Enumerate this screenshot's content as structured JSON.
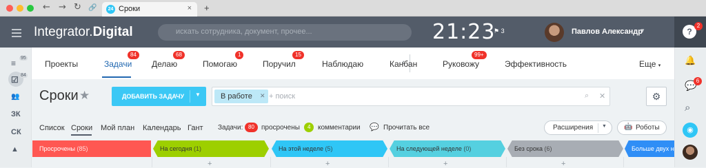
{
  "browser": {
    "tab_title": "Сроки",
    "tab_favicon": "24",
    "tab_close": "×",
    "new_tab": "+",
    "back_icon": "←",
    "forward_icon": "→",
    "reload_icon": "↻",
    "link_icon": "🔗"
  },
  "header": {
    "logo_light": "Integrator.",
    "logo_bold": "Digital",
    "search_placeholder": "искать сотрудника, документ, прочее...",
    "clock": "21:23",
    "flag_count": "3",
    "user_name": "Павлов Александр",
    "help_badge": "2"
  },
  "left_sidebar": [
    {
      "icon": "filter-icon",
      "glyph": "≡",
      "badge": "95"
    },
    {
      "icon": "tasks-icon",
      "glyph": "☑",
      "badge": "84"
    },
    {
      "icon": "group-icon",
      "glyph": "👥",
      "badge": ""
    },
    {
      "icon": "text",
      "glyph": "ЗК",
      "badge": ""
    },
    {
      "icon": "text",
      "glyph": "СК",
      "badge": ""
    },
    {
      "icon": "android-icon",
      "glyph": "▲",
      "badge": ""
    }
  ],
  "right_sidebar": {
    "bell": "🔔",
    "chat_badge": "6",
    "search": "⌕"
  },
  "main_tabs": [
    {
      "label": "Проекты",
      "badge": ""
    },
    {
      "label": "Задачи",
      "badge": "84"
    },
    {
      "label": "Делаю",
      "badge": "68"
    },
    {
      "label": "Помогаю",
      "badge": "1"
    },
    {
      "label": "Поручил",
      "badge": "15"
    },
    {
      "label": "Наблюдаю",
      "badge": ""
    },
    {
      "label": "Канбан",
      "badge": ""
    },
    {
      "label": "Руковожу",
      "badge": "99+"
    },
    {
      "label": "Эффективность",
      "badge": ""
    },
    {
      "label": "Еще",
      "badge": ""
    }
  ],
  "page": {
    "title": "Сроки",
    "add_task": "ДОБАВИТЬ ЗАДАЧУ",
    "filter_chip": "В работе",
    "filter_placeholder": "+ поиск"
  },
  "subnav": {
    "items": [
      "Список",
      "Сроки",
      "Мой план",
      "Календарь",
      "Гант"
    ],
    "active": "Сроки",
    "tasks_label": "Задачи:",
    "overdue_count": "80",
    "overdue_label": "просрочены",
    "comments_count": "4",
    "comments_label": "комментарии",
    "read_all": "Прочитать все",
    "extensions": "Расширения",
    "robots": "Роботы"
  },
  "columns": [
    {
      "name": "Просрочены",
      "count": "(85)",
      "color": "#ff5752"
    },
    {
      "name": "На сегодня",
      "count": "(1)",
      "color": "#9dcf00"
    },
    {
      "name": "На этой неделе",
      "count": "(5)",
      "color": "#2fc6f6"
    },
    {
      "name": "На следующей неделе",
      "count": "(0)",
      "color": "#55d0e0"
    },
    {
      "name": "Без срока",
      "count": "(6)",
      "color": "#a8adb4"
    },
    {
      "name": "Больше двух н",
      "count": "",
      "color": "#2f8ef6"
    }
  ],
  "colors": {
    "header_bg": "#535c69",
    "accent_blue": "#2067b0",
    "add_button": "#3bc8f5",
    "badge_red": "#f0322a",
    "comments_green": "#9dcf00"
  }
}
